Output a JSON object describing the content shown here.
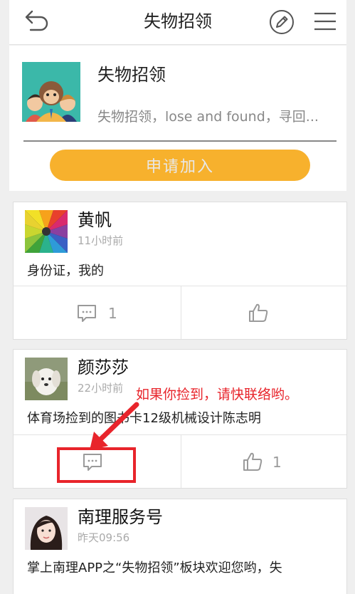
{
  "header": {
    "title": "失物招领",
    "back_icon": "back-arrow-icon",
    "edit_icon": "pencil-icon",
    "menu_icon": "hamburger-menu-icon"
  },
  "group": {
    "name": "失物招领",
    "description": "失物招领，lose and found，寻回...",
    "join_label": "申请加入",
    "accent_color": "#f7b12d"
  },
  "posts": [
    {
      "author": "黄帆",
      "time": "11小时前",
      "content": "身份证，我的",
      "comments": "1",
      "likes": ""
    },
    {
      "author": "颜莎莎",
      "time": "22小时前",
      "content": "体育场捡到的图书卡12级机械设计陈志明",
      "comments": "",
      "likes": "1"
    },
    {
      "author": "南理服务号",
      "time": "昨天09:56",
      "content": "掌上南理APP之“失物招领”板块欢迎您哟，失"
    }
  ],
  "annotation": {
    "text": "如果你捡到，请快联络哟。",
    "color": "#e8242b"
  }
}
